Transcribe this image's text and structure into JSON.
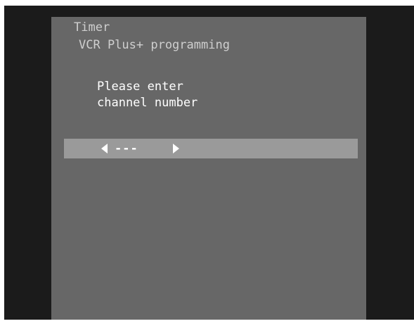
{
  "menu": {
    "title": "Timer",
    "subtitle": "VCR Plus+ programming"
  },
  "prompt": {
    "line1": "Please enter",
    "line2": "channel number"
  },
  "channel_entry": {
    "value": "---",
    "left_icon": "left-arrow-icon",
    "right_icon": "right-arrow-icon"
  },
  "colors": {
    "screen_background": "#1b1b1b",
    "panel_background": "#676767",
    "entry_bar": "#9a9a9a",
    "header_text": "#cfcfcf",
    "prompt_text": "#ffffff"
  }
}
